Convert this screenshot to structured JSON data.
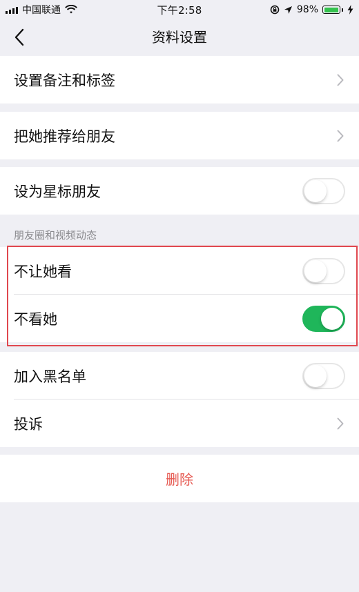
{
  "status_bar": {
    "carrier": "中国联通",
    "time": "下午2:58",
    "battery_percent": "98%",
    "battery_level": 0.98,
    "icons": [
      "signal-icon",
      "wifi-icon",
      "screen-lock-icon",
      "location-arrow-icon",
      "battery-icon",
      "charging-bolt-icon"
    ]
  },
  "nav": {
    "title": "资料设置",
    "back_icon": "chevron-left-icon"
  },
  "groups": {
    "remark": {
      "label": "设置备注和标签"
    },
    "recommend": {
      "label": "把她推荐给朋友"
    },
    "star": {
      "label": "设为星标朋友",
      "toggle": false
    },
    "moments_header": "朋友圈和视频动态",
    "hide_from_her": {
      "label": "不让她看",
      "toggle": false
    },
    "dont_see_her": {
      "label": "不看她",
      "toggle": true
    },
    "blacklist": {
      "label": "加入黑名单",
      "toggle": false
    },
    "complain": {
      "label": "投诉"
    },
    "delete": {
      "label": "删除"
    }
  },
  "colors": {
    "toggle_on": "#1fb65a",
    "delete_text": "#e65a52",
    "highlight_border": "#e0474e",
    "background": "#efeff4"
  }
}
